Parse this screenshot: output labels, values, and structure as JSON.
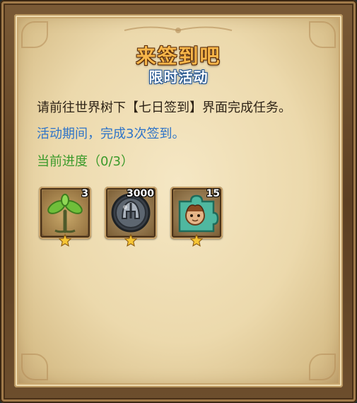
{
  "panel": {
    "title": "来签到吧",
    "subtitle": "限时活动",
    "description": "请前往世界树下【七日签到】界面完成任务。",
    "period_text": "活动期间，完成3次签到。",
    "progress_text": "当前进度（0/3）"
  },
  "rewards": [
    {
      "icon": "sprout-icon",
      "count": "3"
    },
    {
      "icon": "helmet-coin-icon",
      "count": "3000"
    },
    {
      "icon": "puzzle-piece-icon",
      "count": "15"
    }
  ],
  "colors": {
    "title": "#f7b64a",
    "subtitle_outline": "#1d4f8c",
    "period": "#2f74c8",
    "progress": "#3a9a2a",
    "star": "#f6c534"
  }
}
